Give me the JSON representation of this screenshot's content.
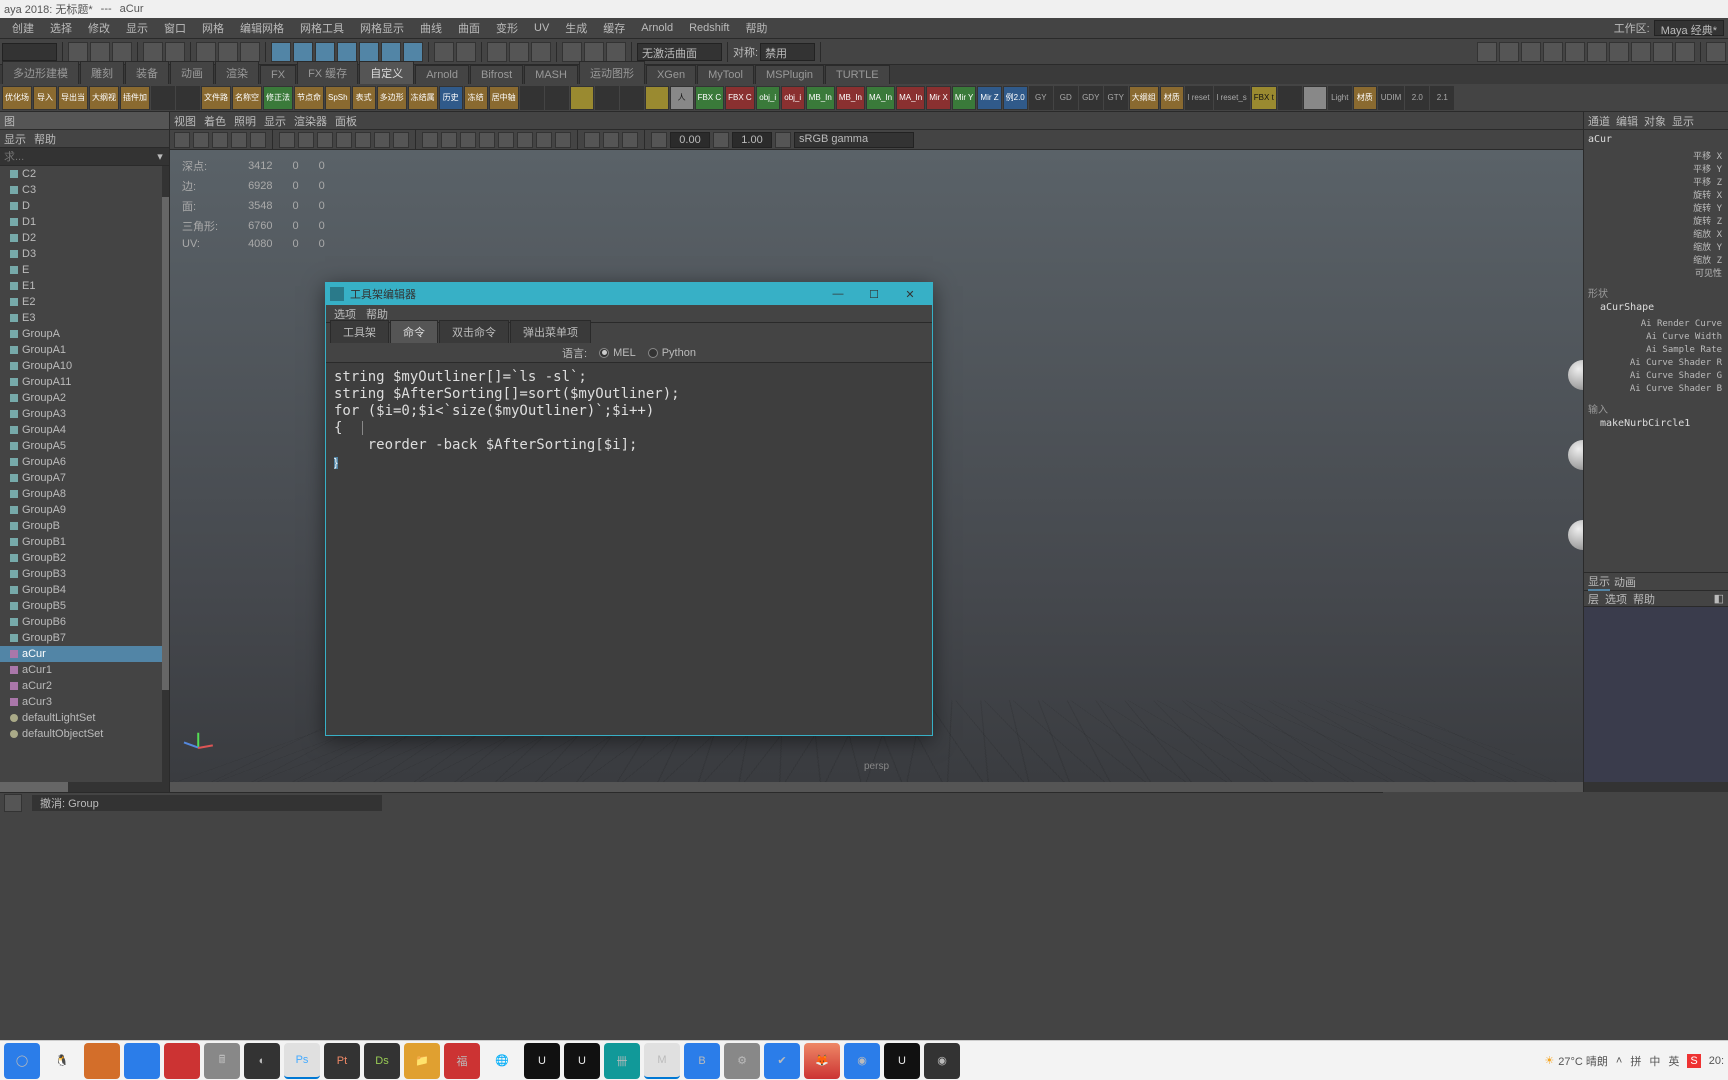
{
  "titlebar": {
    "name1": "aya 2018: 无标题*",
    "sep": "---",
    "name2": "aCur"
  },
  "mainmenu": [
    "创建",
    "选择",
    "修改",
    "显示",
    "窗口",
    "网格",
    "编辑网格",
    "网格工具",
    "网格显示",
    "曲线",
    "曲面",
    "变形",
    "UV",
    "生成",
    "缓存",
    "Arnold",
    "Redshift",
    "帮助"
  ],
  "workspace": {
    "label": "工作区:",
    "value": "Maya 经典*"
  },
  "toolbar1": {
    "curveSel": "无激活曲面",
    "symLabel": "对称:",
    "symValue": "禁用"
  },
  "shelfTabs": [
    "多边形建模",
    "雕刻",
    "装备",
    "动画",
    "渲染",
    "FX",
    "FX 缓存",
    "自定义",
    "Arnold",
    "Bifrost",
    "MASH",
    "运动图形",
    "XGen",
    "MyTool",
    "MSPlugin",
    "TURTLE"
  ],
  "shelfActive": "自定义",
  "shelfIcons": [
    {
      "t": "优化场",
      "c": "orange"
    },
    {
      "t": "导入",
      "c": "orange"
    },
    {
      "t": "导出当",
      "c": "orange"
    },
    {
      "t": "大纲视",
      "c": "orange"
    },
    {
      "t": "插件加",
      "c": "orange"
    },
    {
      "t": "",
      "c": "dark"
    },
    {
      "t": "",
      "c": "dark"
    },
    {
      "t": "文件路",
      "c": "orange"
    },
    {
      "t": "名称空",
      "c": "orange"
    },
    {
      "t": "修正法",
      "c": "green"
    },
    {
      "t": "节点命",
      "c": "orange"
    },
    {
      "t": "SpSh",
      "c": "orange"
    },
    {
      "t": "表式",
      "c": "orange"
    },
    {
      "t": "多边形",
      "c": "orange"
    },
    {
      "t": "冻结属",
      "c": "orange"
    },
    {
      "t": "历史",
      "c": "blue"
    },
    {
      "t": "冻结",
      "c": "orange"
    },
    {
      "t": "居中轴",
      "c": "orange"
    },
    {
      "t": "",
      "c": "dark"
    },
    {
      "t": "",
      "c": "dark"
    },
    {
      "t": "",
      "c": "yellow"
    },
    {
      "t": "",
      "c": "dark"
    },
    {
      "t": "",
      "c": "dark"
    },
    {
      "t": "",
      "c": "yellow"
    },
    {
      "t": "人",
      "c": "light"
    },
    {
      "t": "FBX C",
      "c": "green"
    },
    {
      "t": "FBX C",
      "c": "red"
    },
    {
      "t": "obj_i",
      "c": "green"
    },
    {
      "t": "obj_i",
      "c": "red"
    },
    {
      "t": "MB_In",
      "c": "green"
    },
    {
      "t": "MB_In",
      "c": "red"
    },
    {
      "t": "MA_In",
      "c": "green"
    },
    {
      "t": "MA_In",
      "c": "red"
    },
    {
      "t": "Mir X",
      "c": "red"
    },
    {
      "t": "Mir Y",
      "c": "green"
    },
    {
      "t": "Mir Z",
      "c": "blue"
    },
    {
      "t": "例2.0",
      "c": "blue"
    },
    {
      "t": "GY",
      "c": "dark"
    },
    {
      "t": "GD",
      "c": "dark"
    },
    {
      "t": "GDY",
      "c": "dark"
    },
    {
      "t": "GTY",
      "c": "dark"
    },
    {
      "t": "大纲组",
      "c": "orange"
    },
    {
      "t": "材质",
      "c": "orange"
    },
    {
      "t": "l reset",
      "c": "dark"
    },
    {
      "t": "l reset_s",
      "c": "dark"
    },
    {
      "t": "FBX t",
      "c": "yellow"
    },
    {
      "t": "",
      "c": "dark"
    },
    {
      "t": "",
      "c": "light"
    },
    {
      "t": "Light",
      "c": "dark"
    },
    {
      "t": "材质",
      "c": "orange"
    },
    {
      "t": "UDIM",
      "c": "dark"
    },
    {
      "t": "2.0",
      "c": "dark"
    },
    {
      "t": "2.1",
      "c": "dark"
    }
  ],
  "outliner": {
    "title": "图",
    "menu": [
      "显示",
      "帮助"
    ],
    "search": "求...",
    "items": [
      {
        "n": "C2",
        "i": "mesh"
      },
      {
        "n": "C3",
        "i": "mesh"
      },
      {
        "n": "D",
        "i": "mesh"
      },
      {
        "n": "D1",
        "i": "mesh"
      },
      {
        "n": "D2",
        "i": "mesh"
      },
      {
        "n": "D3",
        "i": "mesh"
      },
      {
        "n": "E",
        "i": "mesh"
      },
      {
        "n": "E1",
        "i": "mesh"
      },
      {
        "n": "E2",
        "i": "mesh"
      },
      {
        "n": "E3",
        "i": "mesh"
      },
      {
        "n": "GroupA",
        "i": "mesh"
      },
      {
        "n": "GroupA1",
        "i": "mesh"
      },
      {
        "n": "GroupA10",
        "i": "mesh"
      },
      {
        "n": "GroupA11",
        "i": "mesh"
      },
      {
        "n": "GroupA2",
        "i": "mesh"
      },
      {
        "n": "GroupA3",
        "i": "mesh"
      },
      {
        "n": "GroupA4",
        "i": "mesh"
      },
      {
        "n": "GroupA5",
        "i": "mesh"
      },
      {
        "n": "GroupA6",
        "i": "mesh"
      },
      {
        "n": "GroupA7",
        "i": "mesh"
      },
      {
        "n": "GroupA8",
        "i": "mesh"
      },
      {
        "n": "GroupA9",
        "i": "mesh"
      },
      {
        "n": "GroupB",
        "i": "mesh"
      },
      {
        "n": "GroupB1",
        "i": "mesh"
      },
      {
        "n": "GroupB2",
        "i": "mesh"
      },
      {
        "n": "GroupB3",
        "i": "mesh"
      },
      {
        "n": "GroupB4",
        "i": "mesh"
      },
      {
        "n": "GroupB5",
        "i": "mesh"
      },
      {
        "n": "GroupB6",
        "i": "mesh"
      },
      {
        "n": "GroupB7",
        "i": "mesh"
      },
      {
        "n": "aCur",
        "i": "curve",
        "sel": true
      },
      {
        "n": "aCur1",
        "i": "curve"
      },
      {
        "n": "aCur2",
        "i": "curve"
      },
      {
        "n": "aCur3",
        "i": "curve"
      },
      {
        "n": "defaultLightSet",
        "i": "set"
      },
      {
        "n": "defaultObjectSet",
        "i": "set"
      }
    ]
  },
  "viewport": {
    "menus": [
      "视图",
      "着色",
      "照明",
      "显示",
      "渲染器",
      "面板"
    ],
    "gammaInput": "sRGB gamma",
    "numA": "0.00",
    "numB": "1.00",
    "camera": "persp",
    "stats": {
      "rows": [
        {
          "l": "深点:",
          "a": "3412",
          "b": "0",
          "c": "0"
        },
        {
          "l": "边:",
          "a": "6928",
          "b": "0",
          "c": "0"
        },
        {
          "l": "面:",
          "a": "3548",
          "b": "0",
          "c": "0"
        },
        {
          "l": "三角形:",
          "a": "6760",
          "b": "0",
          "c": "0"
        },
        {
          "l": "UV:",
          "a": "4080",
          "b": "0",
          "c": "0"
        }
      ]
    }
  },
  "channelbox": {
    "tabs": [
      "通道",
      "编辑",
      "对象",
      "显示"
    ],
    "node": "aCur",
    "attrs": [
      "平移 X",
      "平移 Y",
      "平移 Z",
      "旋转 X",
      "旋转 Y",
      "旋转 Z",
      "缩放 X",
      "缩放 Y",
      "缩放 Z",
      "可见性"
    ],
    "shapeLabel": "形状",
    "shapeNode": "aCurShape",
    "shapeAttrs": [
      "Ai Render Curve",
      "Ai Curve Width",
      "Ai Sample Rate",
      "Ai Curve Shader R",
      "Ai Curve Shader G",
      "Ai Curve Shader B"
    ],
    "inputLabel": "输入",
    "inputNode": "makeNurbCircle1",
    "layerTabs": [
      "显示",
      "动画"
    ],
    "layerMenu": [
      "层",
      "选项",
      "帮助"
    ]
  },
  "shelfEditor": {
    "title": "工具架编辑器",
    "menus": [
      "选项",
      "帮助"
    ],
    "tabs": [
      "工具架",
      "命令",
      "双击命令",
      "弹出菜单项"
    ],
    "activeTab": "命令",
    "langLabel": "语言:",
    "langMel": "MEL",
    "langPy": "Python",
    "code": "string $myOutliner[]=`ls -sl`;\nstring $AfterSorting[]=sort($myOutliner);\nfor ($i=0;$i<`size($myOutliner)`;$i++)\n{\n    reorder -back $AfterSorting[$i];\n}"
  },
  "status": {
    "msg": "撤消: Group"
  },
  "tray": {
    "temp": "27°C 晴朗",
    "ime1": "拼",
    "ime2": "中",
    "ime3": "英",
    "time": "20:"
  }
}
